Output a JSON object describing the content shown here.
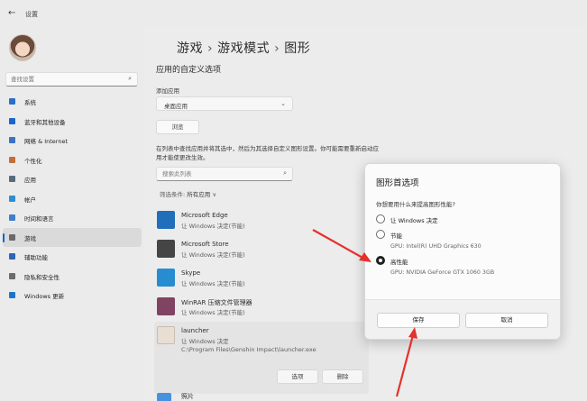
{
  "window": {
    "title": "设置",
    "back_glyph": "←"
  },
  "sidebar": {
    "search_placeholder": "查找设置",
    "items": [
      {
        "label": "系统",
        "color": "#2b6fc6"
      },
      {
        "label": "蓝牙和其他设备",
        "color": "#1a67c8"
      },
      {
        "label": "网络 & Internet",
        "color": "#3b73c4"
      },
      {
        "label": "个性化",
        "color": "#c2703a"
      },
      {
        "label": "应用",
        "color": "#5b6a7c"
      },
      {
        "label": "帐户",
        "color": "#2d8fd0"
      },
      {
        "label": "时间和语言",
        "color": "#3f7fca"
      },
      {
        "label": "游戏",
        "color": "#6a6a6a",
        "active": true
      },
      {
        "label": "辅助功能",
        "color": "#2c66b7"
      },
      {
        "label": "隐私和安全性",
        "color": "#6c6c6c"
      },
      {
        "label": "Windows 更新",
        "color": "#1f74c9"
      }
    ]
  },
  "main": {
    "breadcrumb": [
      "游戏",
      "游戏模式",
      "图形"
    ],
    "breadcrumb_sep": "›",
    "section_title": "应用的自定义选项",
    "add_app_label": "添加应用",
    "app_type_value": "桌面应用",
    "browse_label": "浏览",
    "description": "在列表中查找应用并将其选中，然后为其选择自定义图形设置。你可能需要重新启动应用才能使更改生效。",
    "app_search_placeholder": "搜索此列表",
    "filter_label": "筛选条件:",
    "filter_value": "所有应用",
    "apps": [
      {
        "name": "Microsoft Edge",
        "status": "让 Windows 决定(节能)",
        "icon_color": "#1667b8"
      },
      {
        "name": "Microsoft Store",
        "status": "让 Windows 决定(节能)",
        "icon_color": "#3c3c3c"
      },
      {
        "name": "Skype",
        "status": "让 Windows 决定(节能)",
        "icon_color": "#1d86cf"
      },
      {
        "name": "WinRAR 压缩文件管理器",
        "status": "让 Windows 决定(节能)",
        "icon_color": "#7a3a5a"
      }
    ],
    "expanded_app": {
      "name": "launcher",
      "status": "让 Windows 决定",
      "path": "C:\\Program Files\\Genshin Impact\\launcher.exe",
      "options_label": "选项",
      "delete_label": "删除"
    },
    "next_app": {
      "name": "照片"
    }
  },
  "dialog": {
    "title": "图形首选项",
    "question": "你想要用什么来提高图形性能?",
    "options": [
      {
        "label": "让 Windows 决定",
        "sub": "",
        "checked": false
      },
      {
        "label": "节能",
        "sub": "GPU: Intel(R) UHD Graphics 630",
        "checked": false
      },
      {
        "label": "高性能",
        "sub": "GPU: NVIDIA GeForce GTX 1060 3GB",
        "checked": true
      }
    ],
    "save_label": "保存",
    "cancel_label": "取消"
  },
  "annotations": {
    "arrow_color": "#e5312b"
  },
  "icons": {
    "search": "⌕",
    "chevron_down": "⌄",
    "filter_chevron": "∨"
  }
}
